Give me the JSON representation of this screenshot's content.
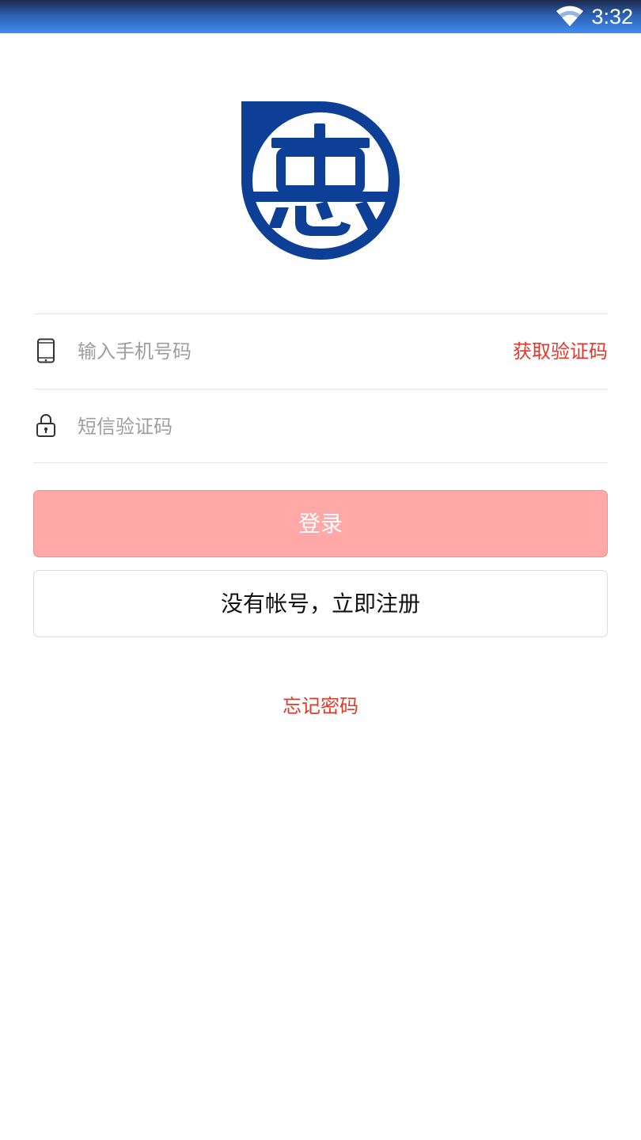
{
  "status_bar": {
    "time": "3:32",
    "wifi_icon": "wifi-icon"
  },
  "logo": {
    "icon": "hui-logo-icon",
    "character": "惠",
    "color": "#0d3f96"
  },
  "login_form": {
    "phone": {
      "icon": "phone-icon",
      "placeholder": "输入手机号码",
      "value": ""
    },
    "get_code_label": "获取验证码",
    "sms_code": {
      "icon": "lock-icon",
      "placeholder": "短信验证码",
      "value": ""
    }
  },
  "actions": {
    "login_label": "登录",
    "register_label": "没有帐号，立即注册",
    "forgot_password_label": "忘记密码"
  },
  "colors": {
    "accent": "#e0392b",
    "login_button": "#ffa8a8",
    "brand_blue": "#0d3f96"
  }
}
